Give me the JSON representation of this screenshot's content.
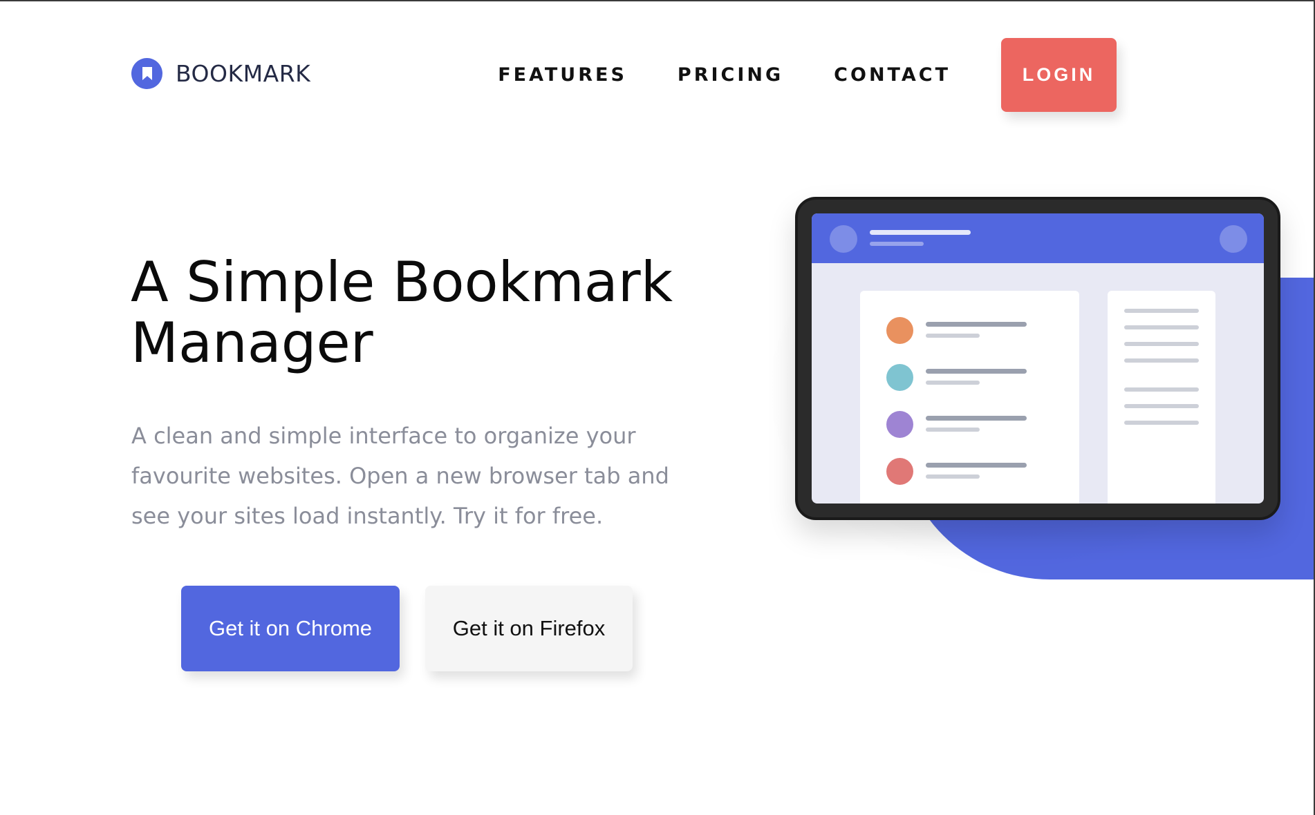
{
  "brand": {
    "name": "BOOKMARK",
    "color": "#5267df"
  },
  "nav": {
    "links": [
      "FEATURES",
      "PRICING",
      "CONTACT"
    ],
    "login_label": "LOGIN",
    "login_color": "#ec6660"
  },
  "hero": {
    "title": "A Simple Bookmark Manager",
    "subtitle": "A clean and simple interface to organize your favourite websites. Open a new browser tab and see your sites load instantly. Try it for free.",
    "chrome_label": "Get it on Chrome",
    "firefox_label": "Get it on Firefox"
  },
  "illustration": {
    "row_colors": [
      "#e9915f",
      "#7fc4d1",
      "#9e84d3",
      "#e07876"
    ],
    "accent": "#5267df",
    "icons": [
      "bookmark-logo-icon",
      "tablet-illustration"
    ]
  }
}
